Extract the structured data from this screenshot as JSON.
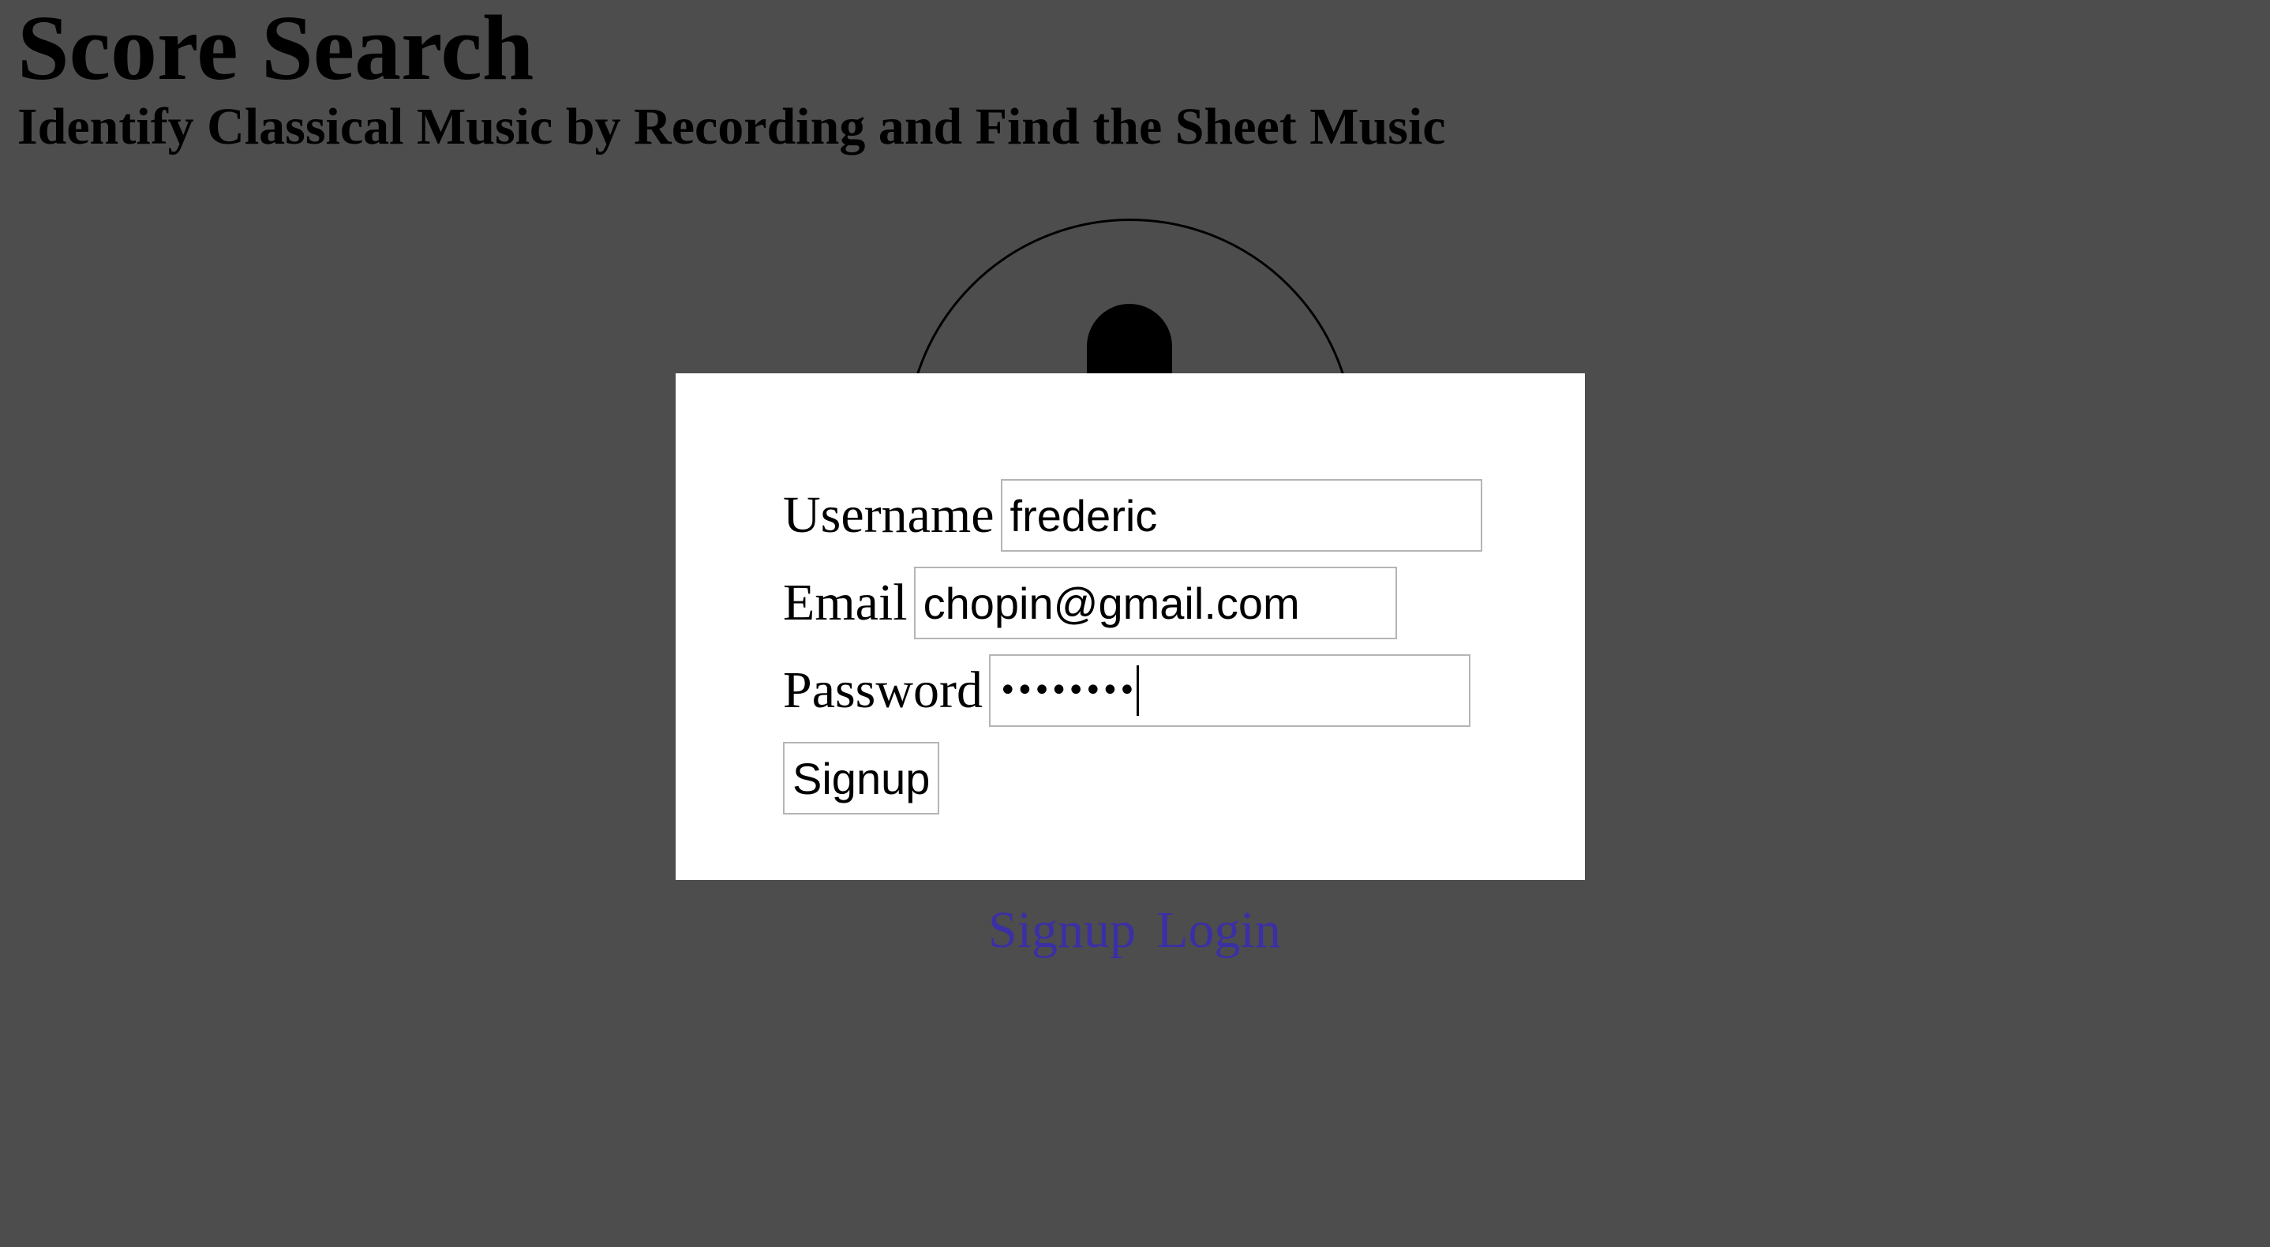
{
  "header": {
    "title": "Score Search",
    "subtitle": "Identify Classical Music by Recording and Find the Sheet Music"
  },
  "recorder": {
    "icon": "microphone-icon"
  },
  "signup_form": {
    "username_label": "Username",
    "username_value": "frederic",
    "email_label": "Email",
    "email_value": "chopin@gmail.com",
    "password_label": "Password",
    "password_masked": "••••••••",
    "submit_label": "Signup"
  },
  "nav": {
    "signup_link": "Signup",
    "login_link": "Login"
  },
  "colors": {
    "background": "#4d4d4d",
    "modal": "#ffffff",
    "link": "#3b2fa6"
  }
}
